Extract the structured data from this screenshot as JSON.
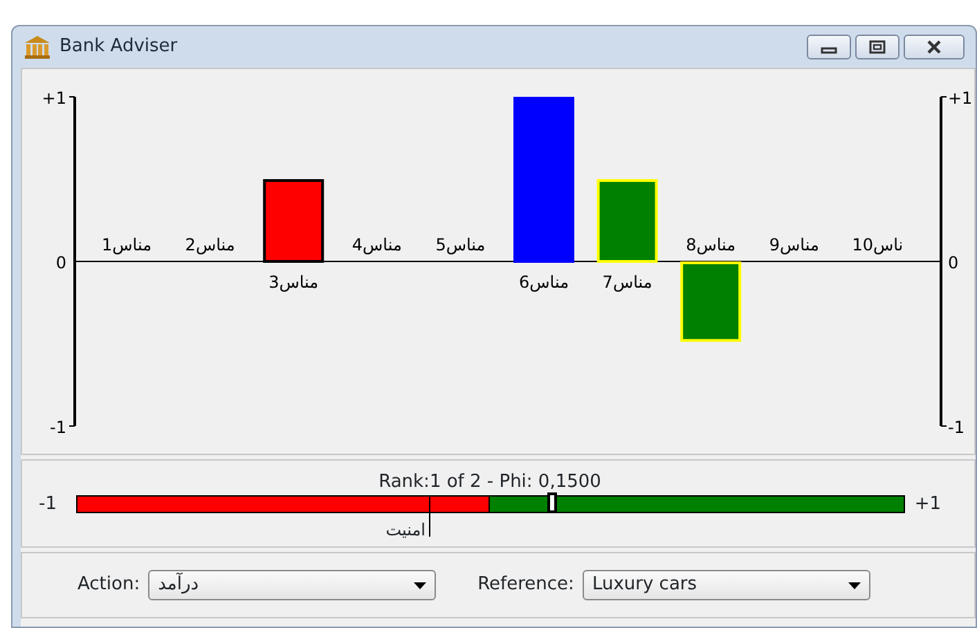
{
  "window": {
    "title": "Bank Adviser",
    "buttons": [
      {
        "kind": "minimize"
      },
      {
        "kind": "maximize"
      },
      {
        "kind": "close"
      }
    ]
  },
  "chart": {
    "chart_data": {
      "type": "bar",
      "categories": [
        "مناس1",
        "مناس2",
        "مناس3",
        "مناس4",
        "مناس5",
        "مناس6",
        "مناس7",
        "مناس8",
        "مناس9",
        "ناس10"
      ],
      "series": [
        {
          "color": "#ff0000",
          "values": [
            null,
            null,
            0.5,
            null,
            null,
            null,
            null,
            null,
            null,
            null
          ]
        },
        {
          "color": "#0000ff",
          "values": [
            null,
            null,
            null,
            null,
            null,
            1.0,
            null,
            null,
            null,
            null
          ]
        },
        {
          "color": "#008000",
          "values": [
            null,
            null,
            null,
            null,
            null,
            null,
            0.5,
            -0.48,
            null,
            null
          ]
        }
      ],
      "ylim": [
        -1,
        1
      ],
      "y2lim": [
        -1,
        1
      ],
      "yticks": [
        {
          "value": 1,
          "label": "+1"
        },
        {
          "value": 0,
          "label": "0"
        },
        {
          "value": -1,
          "label": "-1"
        }
      ],
      "y2ticks": [
        {
          "value": 1,
          "label": "+1"
        },
        {
          "value": 0,
          "label": "0"
        },
        {
          "value": -1,
          "label": "-1"
        }
      ]
    },
    "bar_outlines": [
      {
        "color": "#000000"
      },
      {
        "color": "#0000ff"
      },
      {
        "color": "#ffff00"
      }
    ]
  },
  "ranking": {
    "caption": "Rank:1 of 2 - Phi: 0,1500",
    "min_label": "-1",
    "max_label": "+1",
    "bar": {
      "level": 0.5
    },
    "thumb": {
      "level": 0.574
    },
    "marker": {
      "label": "امنیت",
      "level": 0.425
    }
  },
  "action": {
    "label": "Action:",
    "value": "درآمد"
  },
  "reference": {
    "label": "Reference:",
    "value": "Luxury cars"
  }
}
